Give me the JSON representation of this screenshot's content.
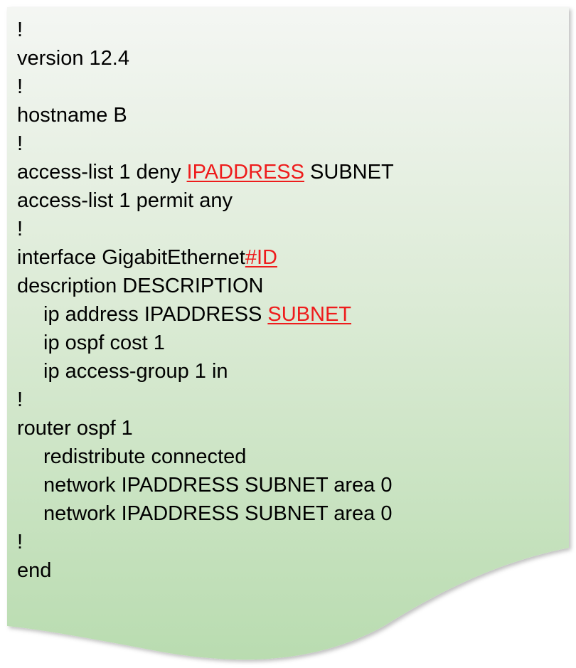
{
  "document": {
    "colors": {
      "gradient_top": "#f4f6f3",
      "gradient_bottom": "#b9dcb0",
      "text": "#000000",
      "highlight": "#ee1c1c"
    },
    "lines": [
      {
        "indent": false,
        "segments": [
          {
            "text": "!",
            "highlight": false
          }
        ]
      },
      {
        "indent": false,
        "segments": [
          {
            "text": "version 12.4",
            "highlight": false
          }
        ]
      },
      {
        "indent": false,
        "segments": [
          {
            "text": "!",
            "highlight": false
          }
        ]
      },
      {
        "indent": false,
        "segments": [
          {
            "text": "hostname B",
            "highlight": false
          }
        ]
      },
      {
        "indent": false,
        "segments": [
          {
            "text": "!",
            "highlight": false
          }
        ]
      },
      {
        "indent": false,
        "segments": [
          {
            "text": "access-list 1 deny ",
            "highlight": false
          },
          {
            "text": "IPADDRESS",
            "highlight": true
          },
          {
            "text": " SUBNET",
            "highlight": false
          }
        ]
      },
      {
        "indent": false,
        "segments": [
          {
            "text": "access-list 1 permit any",
            "highlight": false
          }
        ]
      },
      {
        "indent": false,
        "segments": [
          {
            "text": "!",
            "highlight": false
          }
        ]
      },
      {
        "indent": false,
        "segments": [
          {
            "text": "interface GigabitEthernet",
            "highlight": false
          },
          {
            "text": "#ID",
            "highlight": true
          }
        ]
      },
      {
        "indent": false,
        "segments": [
          {
            "text": "description DESCRIPTION",
            "highlight": false
          }
        ]
      },
      {
        "indent": true,
        "segments": [
          {
            "text": "ip address IPADDRESS ",
            "highlight": false
          },
          {
            "text": "SUBNET",
            "highlight": true
          }
        ]
      },
      {
        "indent": true,
        "segments": [
          {
            "text": "ip ospf cost 1",
            "highlight": false
          }
        ]
      },
      {
        "indent": true,
        "segments": [
          {
            "text": "ip access-group 1 in",
            "highlight": false
          }
        ]
      },
      {
        "indent": false,
        "segments": [
          {
            "text": "!",
            "highlight": false
          }
        ]
      },
      {
        "indent": false,
        "segments": [
          {
            "text": "router ospf 1",
            "highlight": false
          }
        ]
      },
      {
        "indent": true,
        "segments": [
          {
            "text": "redistribute connected",
            "highlight": false
          }
        ]
      },
      {
        "indent": true,
        "segments": [
          {
            "text": "network IPADDRESS SUBNET area 0",
            "highlight": false
          }
        ]
      },
      {
        "indent": true,
        "segments": [
          {
            "text": "network IPADDRESS SUBNET area 0",
            "highlight": false
          }
        ]
      },
      {
        "indent": false,
        "segments": [
          {
            "text": "!",
            "highlight": false
          }
        ]
      },
      {
        "indent": false,
        "segments": [
          {
            "text": "end",
            "highlight": false
          }
        ]
      }
    ]
  }
}
